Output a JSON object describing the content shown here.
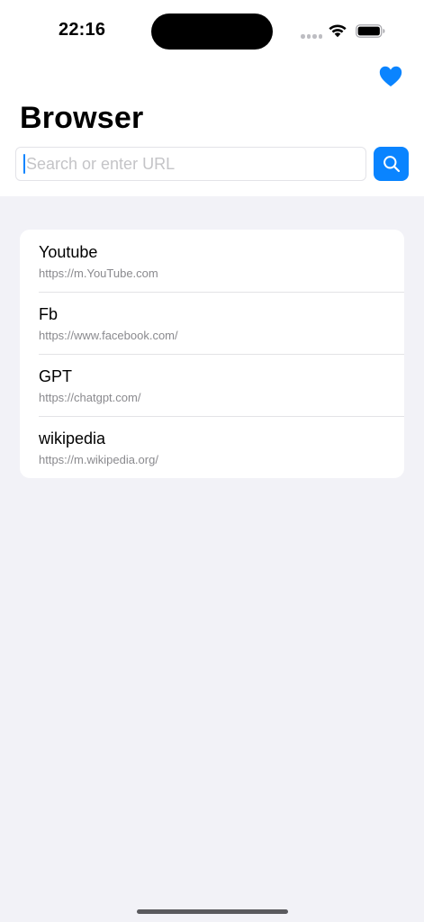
{
  "status_bar": {
    "time": "22:16"
  },
  "header": {
    "title": "Browser",
    "favorites_icon": "heart-fill-icon"
  },
  "search": {
    "value": "",
    "placeholder": "Search or enter URL",
    "button_icon": "magnifying-glass-icon"
  },
  "bookmarks": [
    {
      "title": "Youtube",
      "url": "https://m.YouTube.com"
    },
    {
      "title": "Fb",
      "url": "https://www.facebook.com/"
    },
    {
      "title": "GPT",
      "url": "https://chatgpt.com/"
    },
    {
      "title": "wikipedia",
      "url": "https://m.wikipedia.org/"
    }
  ],
  "colors": {
    "accent": "#0A84FF",
    "background": "#F2F2F7",
    "secondary_text": "#8A8A8E"
  }
}
